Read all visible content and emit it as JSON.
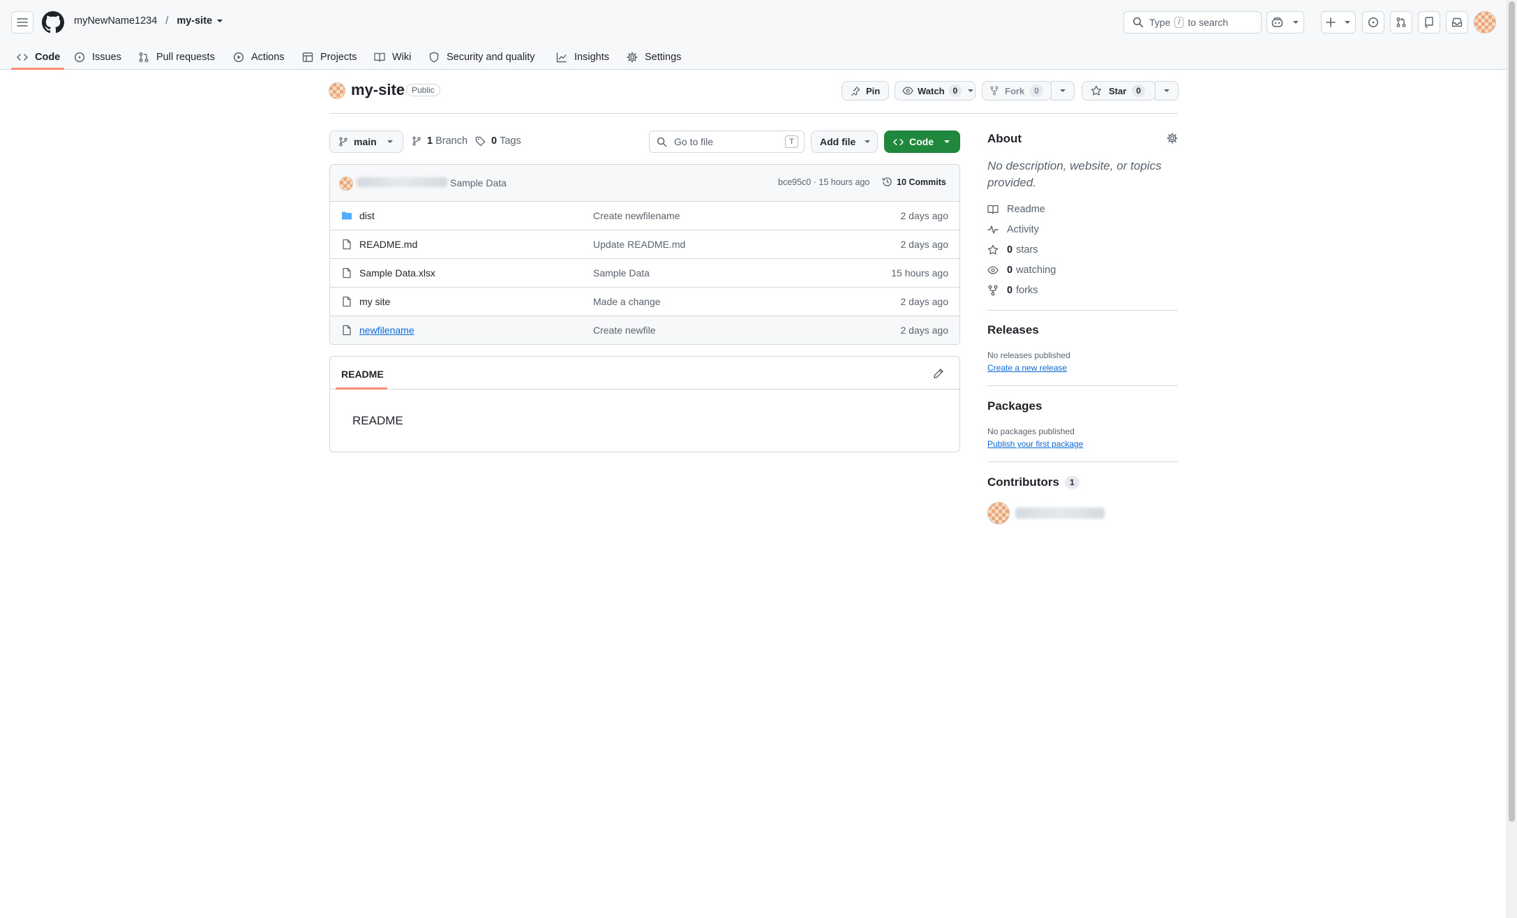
{
  "header": {
    "owner": "myNewName1234",
    "separator": "/",
    "repo": "my-site",
    "search_prefix": "Type",
    "search_key": "/",
    "search_suffix": "to search"
  },
  "nav": {
    "tabs": [
      {
        "label": "Code",
        "icon": "code-icon"
      },
      {
        "label": "Issues",
        "icon": "issue-icon"
      },
      {
        "label": "Pull requests",
        "icon": "pull-request-icon"
      },
      {
        "label": "Actions",
        "icon": "play-icon"
      },
      {
        "label": "Projects",
        "icon": "table-icon"
      },
      {
        "label": "Wiki",
        "icon": "book-icon"
      },
      {
        "label": "Security and quality",
        "icon": "shield-icon"
      },
      {
        "label": "Insights",
        "icon": "graph-icon"
      },
      {
        "label": "Settings",
        "icon": "gear-icon"
      }
    ],
    "active": "Code"
  },
  "repo": {
    "name": "my-site",
    "visibility": "Public",
    "pin_label": "Pin",
    "watch_label": "Watch",
    "watch_count": "0",
    "fork_label": "Fork",
    "fork_count": "0",
    "star_label": "Star",
    "star_count": "0"
  },
  "toolbar": {
    "branch": "main",
    "branch_count": "1",
    "branch_label": "Branch",
    "tag_count": "0",
    "tag_label": "Tags",
    "goto_placeholder": "Go to file",
    "goto_key": "T",
    "add_file_label": "Add file",
    "code_label": "Code"
  },
  "commit": {
    "message": "Sample Data",
    "hash": "bce95c0",
    "time": "15 hours ago",
    "commits_label": "10 Commits"
  },
  "files": [
    {
      "name": "dist",
      "type": "folder",
      "message": "Create newfilename",
      "date": "2 days ago"
    },
    {
      "name": "README.md",
      "type": "file",
      "message": "Update README.md",
      "date": "2 days ago"
    },
    {
      "name": "Sample Data.xlsx",
      "type": "file",
      "message": "Sample Data",
      "date": "15 hours ago"
    },
    {
      "name": "my site",
      "type": "file",
      "message": "Made a change",
      "date": "2 days ago"
    },
    {
      "name": "newfilename",
      "type": "file",
      "message": "Create newfile",
      "date": "2 days ago"
    }
  ],
  "readme": {
    "tab_label": "README",
    "content": "README"
  },
  "about": {
    "title": "About",
    "description": "No description, website, or topics provided.",
    "links": [
      {
        "label": "Readme",
        "icon": "book-icon"
      },
      {
        "label": "Activity",
        "icon": "pulse-icon"
      },
      {
        "count": "0",
        "label": "stars",
        "icon": "star-icon"
      },
      {
        "count": "0",
        "label": "watching",
        "icon": "eye-icon"
      },
      {
        "count": "0",
        "label": "forks",
        "icon": "fork-icon"
      }
    ]
  },
  "releases": {
    "title": "Releases",
    "empty": "No releases published",
    "link": "Create a new release"
  },
  "packages": {
    "title": "Packages",
    "empty": "No packages published",
    "link": "Publish your first package"
  },
  "contributors": {
    "title": "Contributors",
    "count": "1"
  },
  "colors": {
    "accent_underline": "#fd8c73",
    "code_button": "#1f883d",
    "link": "#0969da"
  }
}
